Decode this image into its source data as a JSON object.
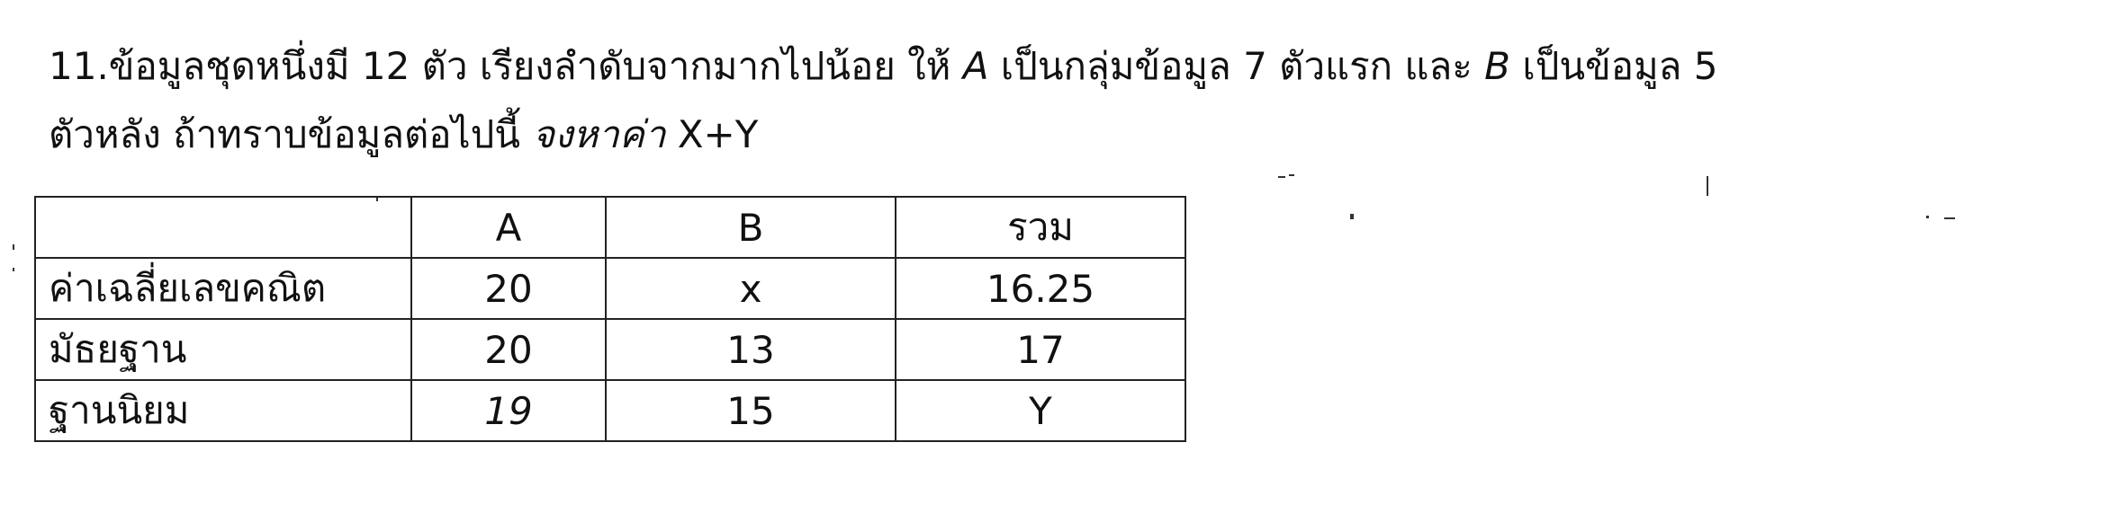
{
  "question": {
    "number": "11.",
    "line1_part1": "ข้อมูลชุดหนึ่งมี 12 ตัว เรียงลำดับจากมากไปน้อย ให้ ",
    "var_a": "A",
    "line1_part2": " เป็นกลุ่มข้อมูล 7 ตัวแรก และ ",
    "var_b": "B",
    "line1_part3": " เป็นข้อมูล 5",
    "line2_part1": "ตัวหลัง ถ้าทราบข้อมูลต่อไปนี้ ",
    "line2_instruction": "จงหาค่า",
    "line2_target": " X+Y"
  },
  "table": {
    "headers": [
      "",
      "A",
      "B",
      "รวม"
    ],
    "rows": [
      {
        "label": "ค่าเฉลี่ยเลขคณิต",
        "a": "20",
        "b": "x",
        "total": "16.25"
      },
      {
        "label": "มัธยฐาน",
        "a": "20",
        "b": "13",
        "total": "17"
      },
      {
        "label": "ฐานนิยม",
        "a": "19",
        "b": "15",
        "total": "Y"
      }
    ]
  }
}
